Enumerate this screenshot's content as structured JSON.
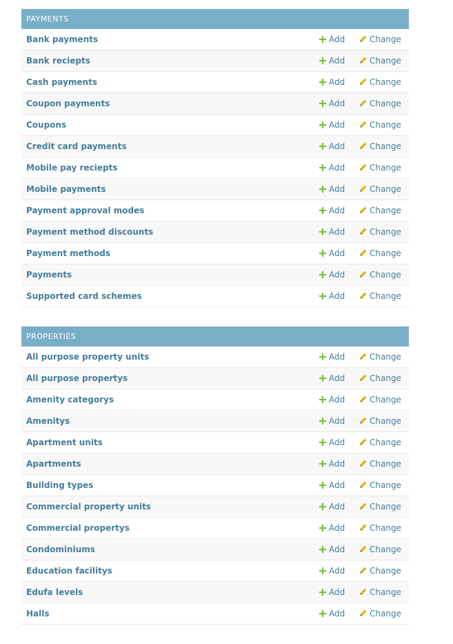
{
  "icons": {
    "add": "plus-icon",
    "change": "pencil-icon"
  },
  "colors": {
    "caption_bg": "#79aec8",
    "link": "#447e9b",
    "add_icon": "#70bf2b",
    "change_icon": "#efb80b"
  },
  "modules": [
    {
      "caption": "PAYMENTS",
      "add_label": "Add",
      "change_label": "Change",
      "models": [
        "Bank payments",
        "Bank reciepts",
        "Cash payments",
        "Coupon payments",
        "Coupons",
        "Credit card payments",
        "Mobile pay reciepts",
        "Mobile payments",
        "Payment approval modes",
        "Payment method discounts",
        "Payment methods",
        "Payments",
        "Supported card schemes"
      ]
    },
    {
      "caption": "PROPERTIES",
      "add_label": "Add",
      "change_label": "Change",
      "models": [
        "All purpose property units",
        "All purpose propertys",
        "Amenity categorys",
        "Amenitys",
        "Apartment units",
        "Apartments",
        "Building types",
        "Commercial property units",
        "Commercial propertys",
        "Condominiums",
        "Education facilitys",
        "Edufa levels",
        "Halls"
      ]
    }
  ]
}
